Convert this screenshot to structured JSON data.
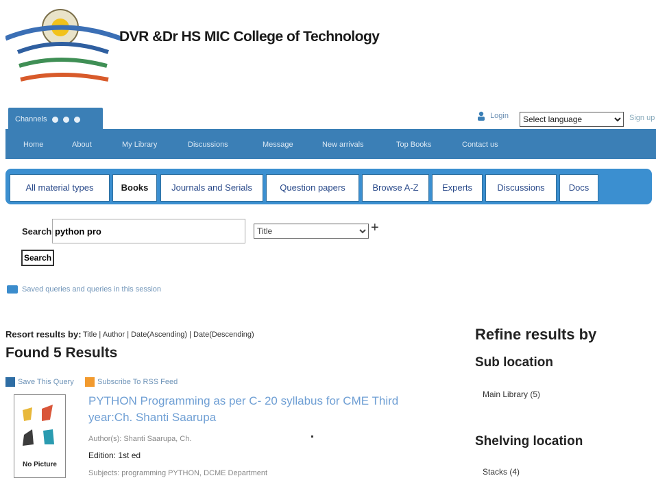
{
  "header": {
    "college_name": "DVR &Dr HS MIC College of Technology"
  },
  "top_tab": {
    "label": "Channels"
  },
  "account": {
    "login": "Login",
    "language_select": "Select language",
    "sign_up": "Sign up"
  },
  "nav": {
    "items": [
      "Home",
      "About",
      "My Library",
      "Discussions",
      "Message",
      "New arrivals",
      "Top Books",
      "Contact us"
    ]
  },
  "material_tabs": [
    "All material types",
    "Books",
    "Journals and Serials",
    "Question papers",
    "Browse A-Z",
    "Experts",
    "Discussions",
    "Docs"
  ],
  "search": {
    "label": "Search",
    "query": "python pro",
    "field": "Title",
    "plus": "+",
    "button": "Search"
  },
  "saved_queries": "Saved queries and queries in this session",
  "results": {
    "resort_label": "Resort results by:",
    "resort_options": "Title | Author | Date(Ascending) | Date(Descending)",
    "found": "Found 5 Results",
    "save_query": "Save This Query",
    "rss": "Subscribe To RSS Feed",
    "items": [
      {
        "title": "PYTHON Programming as per C- 20 syllabus for CME Third year:Ch. Shanti Saarupa",
        "authors": "Author(s): Shanti Saarupa, Ch.",
        "edition": "Edition: 1st ed",
        "subjects": "Subjects: programming PYTHON, DCME Department",
        "cover_label": "No Picture"
      }
    ]
  },
  "refine": {
    "title": "Refine results by",
    "sub_location": "Sub location",
    "main_library": "Main Library (5)",
    "shelving_location": "Shelving location",
    "stacks": "Stacks (4)"
  },
  "colors": {
    "nav_blue": "#3b7fb6",
    "tab_panel_blue": "#3b8fd0",
    "link_blue": "#6f9fd4"
  }
}
